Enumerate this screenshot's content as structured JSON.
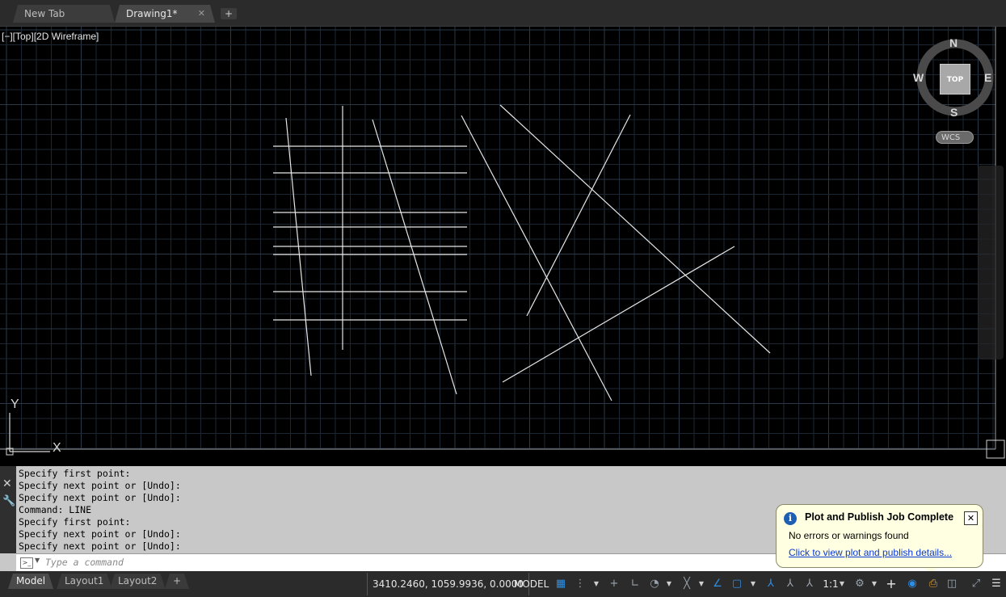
{
  "tabs": [
    {
      "label": "New Tab",
      "active": false
    },
    {
      "label": "Drawing1*",
      "active": true
    }
  ],
  "tab_close": "✕",
  "tab_add": "+",
  "viewport": {
    "label": "[−][Top][2D Wireframe]",
    "background": "#000000",
    "grid_color": "#1c2733",
    "line_color": "#e6e6e6"
  },
  "viewcube": {
    "north": "N",
    "south": "S",
    "east": "E",
    "west": "W",
    "face": "TOP",
    "wcs": "WCS"
  },
  "ucs": {
    "x_label": "X",
    "y_label": "Y"
  },
  "command_history": [
    "Specify first point:",
    "Specify next point or [Undo]:",
    "Specify next point or [Undo]:",
    "Command:  LINE",
    "Specify first point:",
    "Specify next point or [Undo]:",
    "Specify next point or [Undo]:"
  ],
  "command_input": {
    "placeholder": "Type a command"
  },
  "layout_tabs": [
    {
      "label": "Model",
      "active": true
    },
    {
      "label": "Layout1",
      "active": false
    },
    {
      "label": "Layout2",
      "active": false
    }
  ],
  "layout_add": "+",
  "status": {
    "coordinates": "3410.2460, 1059.9936, 0.0000",
    "model": "MODEL",
    "scale": "1:1",
    "icons": [
      "grid-icon",
      "snap-icon",
      "ortho-icon",
      "polar-icon",
      "isodraft-icon",
      "osnap-tracking-icon",
      "osnap-icon",
      "dynamic-ucs-icon",
      "annotation-visibility-icon",
      "autoscale-icon",
      "annotation-scale-icon",
      "workspace-gear-icon",
      "add-icon",
      "isolate-icon",
      "hardware-accel-icon",
      "plot-icon",
      "clean-screen-icon",
      "customize-menu-icon"
    ]
  },
  "notification": {
    "title": "Plot and Publish Job Complete",
    "message": "No errors or warnings found",
    "link": "Click to view plot and publish details...",
    "close": "✕",
    "info": "i"
  }
}
